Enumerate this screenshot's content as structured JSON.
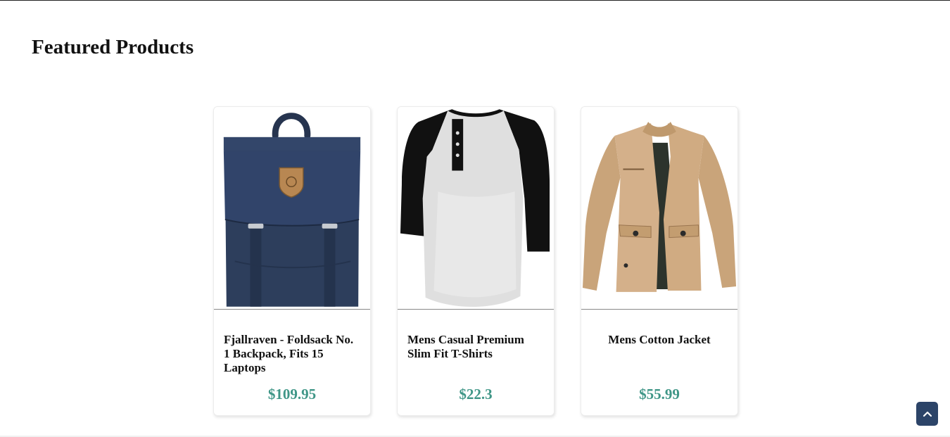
{
  "section": {
    "title": "Featured Products"
  },
  "products": [
    {
      "title": "Fjallraven - Foldsack No. 1 Backpack, Fits 15 Laptops",
      "price": "$109.95",
      "image_icon": "backpack"
    },
    {
      "title": "Mens Casual Premium Slim Fit T-Shirts",
      "price": "$22.3",
      "image_icon": "raglan-tshirt"
    },
    {
      "title": "Mens Cotton Jacket",
      "price": "$55.99",
      "image_icon": "jacket"
    }
  ],
  "scroll_top": {
    "icon": "chevron-up-icon"
  },
  "colors": {
    "price": "#3f9687",
    "scroll_button": "#2c4468"
  }
}
